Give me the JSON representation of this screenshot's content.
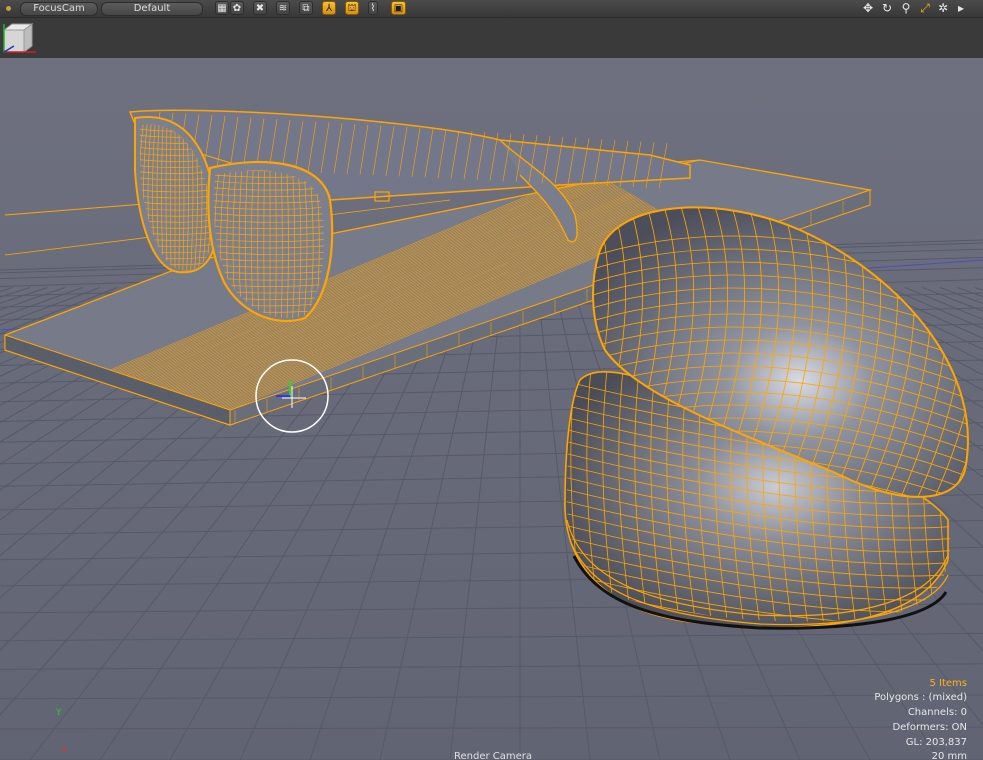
{
  "toolbar": {
    "camera_field": "FocusCam",
    "preset_field": "Default",
    "buttons": [
      {
        "name": "checker-icon",
        "glyph": "▦",
        "active": false
      },
      {
        "name": "shaded-icon",
        "glyph": "✿",
        "active": false
      },
      {
        "name": "wire-icon",
        "glyph": "✖",
        "active": false
      },
      {
        "name": "wave-icon",
        "glyph": "≋",
        "active": false
      },
      {
        "name": "layer-icon",
        "glyph": "⧉",
        "active": false
      },
      {
        "name": "axis-icon",
        "glyph": "⅄",
        "active": true
      },
      {
        "name": "mesh-icon",
        "glyph": "⛫",
        "active": true
      },
      {
        "name": "bone-icon",
        "glyph": "⌇",
        "active": false
      },
      {
        "name": "item-icon",
        "glyph": "▣",
        "active": true
      }
    ],
    "nav_icons": [
      "move-view-icon",
      "rotate-view-icon",
      "zoom-view-icon",
      "fit-view-icon",
      "settings-icon",
      "expand-arrow-icon"
    ]
  },
  "viewport": {
    "items": "5 Items",
    "polygons": "Polygons : (mixed)",
    "channels": "Channels: 0",
    "deformers": "Deformers: ON",
    "gl": "GL: 203,837",
    "focal": "20 mm",
    "camera_label": "Render Camera",
    "axis_x": "x",
    "axis_y": "Y"
  },
  "colors": {
    "wire": "#ffa500",
    "grid": "#5b6070",
    "background": "#6b6e7c"
  }
}
